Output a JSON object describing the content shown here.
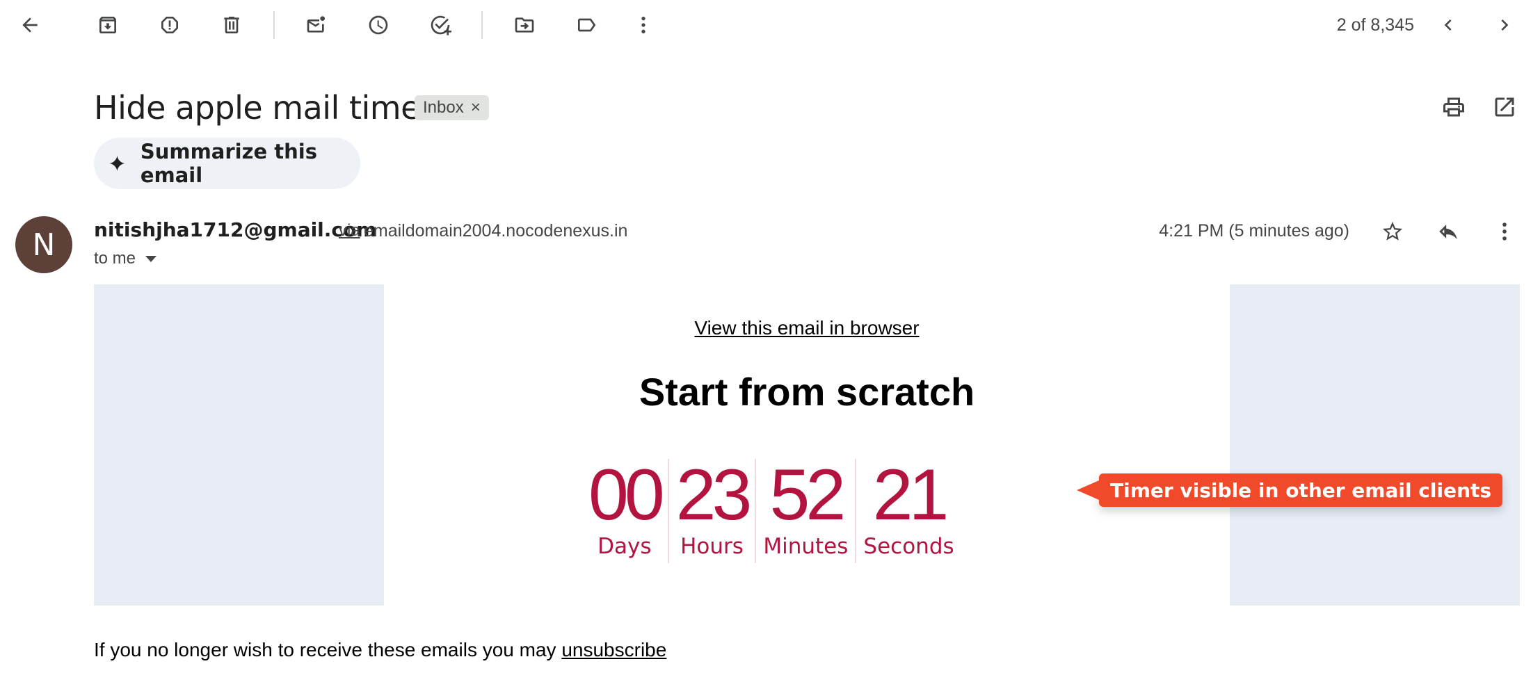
{
  "toolbar": {
    "icons": [
      "back-icon",
      "archive-icon",
      "report-spam-icon",
      "delete-icon",
      "mark-unread-icon",
      "snooze-icon",
      "add-task-icon",
      "move-to-icon",
      "label-icon",
      "more-vert-icon"
    ],
    "count": "2 of 8,345"
  },
  "email": {
    "subject": "Hide apple mail timers",
    "label_chip": "Inbox",
    "chip_close": "×",
    "summarize_label": "Summarize this email",
    "avatar_letter": "N",
    "sender": "nitishjha1712@gmail.com",
    "via": "via",
    "domain": "emaildomain2004.nocodenexus.in",
    "to": "to me",
    "time": "4:21 PM (5 minutes ago)"
  },
  "body": {
    "view_browser": "View this email in browser",
    "headline": "Start from scratch",
    "timer": [
      {
        "value": "00",
        "label": "Days"
      },
      {
        "value": "23",
        "label": "Hours"
      },
      {
        "value": "52",
        "label": "Minutes"
      },
      {
        "value": "21",
        "label": "Seconds"
      }
    ],
    "callout": "Timer visible in other email clients",
    "unsubscribe_text": "If you no longer wish to receive these emails you may ",
    "unsubscribe_link": "unsubscribe"
  },
  "colors": {
    "timer": "#b3143f",
    "callout": "#f14a2a",
    "avatar": "#5d4037",
    "side_block": "#e8ecf5"
  }
}
